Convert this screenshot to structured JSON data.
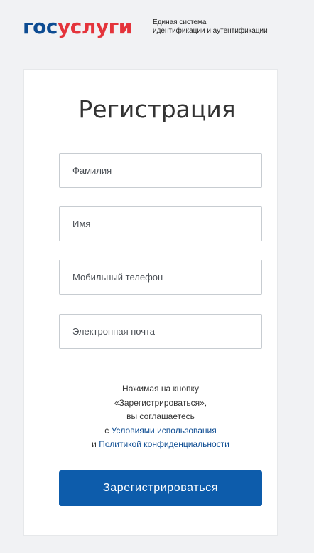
{
  "header": {
    "logo_part1": "гос",
    "logo_part2": "услуги",
    "subtitle_line1": "Единая система",
    "subtitle_line2": "идентификации и аутентификации"
  },
  "form": {
    "title": "Регистрация",
    "fields": [
      {
        "placeholder": "Фамилия",
        "value": ""
      },
      {
        "placeholder": "Имя",
        "value": ""
      },
      {
        "placeholder": "Мобильный телефон",
        "value": ""
      },
      {
        "placeholder": "Электронная почта",
        "value": ""
      }
    ],
    "consent": {
      "line1": "Нажимая на кнопку",
      "line2": "«Зарегистрироваться»,",
      "line3": "вы соглашаетесь",
      "prefix4": "с ",
      "terms_link": "Условиями использования",
      "prefix5": "и ",
      "privacy_link": "Политикой конфиденциальности"
    },
    "submit_label": "Зарегистрироваться"
  },
  "colors": {
    "brand_blue": "#0d4c92",
    "brand_red": "#e4343b",
    "button": "#0d5cab",
    "background": "#f1f2f4"
  }
}
